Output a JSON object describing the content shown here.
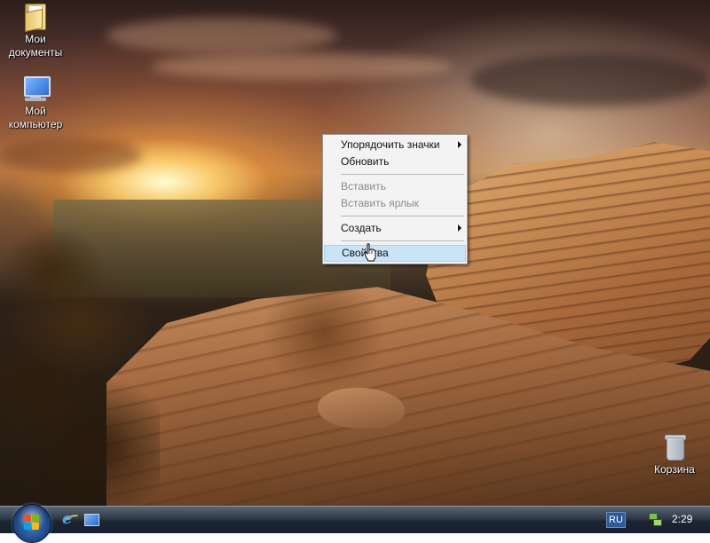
{
  "desktop": {
    "icons": [
      {
        "label_line1": "Мои",
        "label_line2": "документы",
        "icon": "my-documents-folder-icon"
      },
      {
        "label_line1": "Мой",
        "label_line2": "компьютер",
        "icon": "my-computer-icon"
      },
      {
        "label_line1": "Корзина",
        "label_line2": "",
        "icon": "recycle-bin-icon"
      }
    ]
  },
  "context_menu": {
    "items": [
      {
        "label": "Упорядочить значки",
        "submenu": true,
        "enabled": true
      },
      {
        "label": "Обновить",
        "submenu": false,
        "enabled": true
      },
      {
        "label": "Вставить",
        "submenu": false,
        "enabled": false
      },
      {
        "label": "Вставить ярлык",
        "submenu": false,
        "enabled": false
      },
      {
        "label": "Создать",
        "submenu": true,
        "enabled": true
      },
      {
        "label": "Свойства",
        "submenu": false,
        "enabled": true,
        "highlighted": true
      }
    ]
  },
  "taskbar": {
    "start_icon": "windows-orb-icon",
    "quick_launch": [
      "internet-explorer-icon",
      "show-desktop-icon"
    ],
    "language": "RU",
    "clock": "2:29"
  },
  "colors": {
    "menu_highlight": "#c9e4f6",
    "menu_bg": "#f3f3f3",
    "taskbar": "#1c2530"
  }
}
